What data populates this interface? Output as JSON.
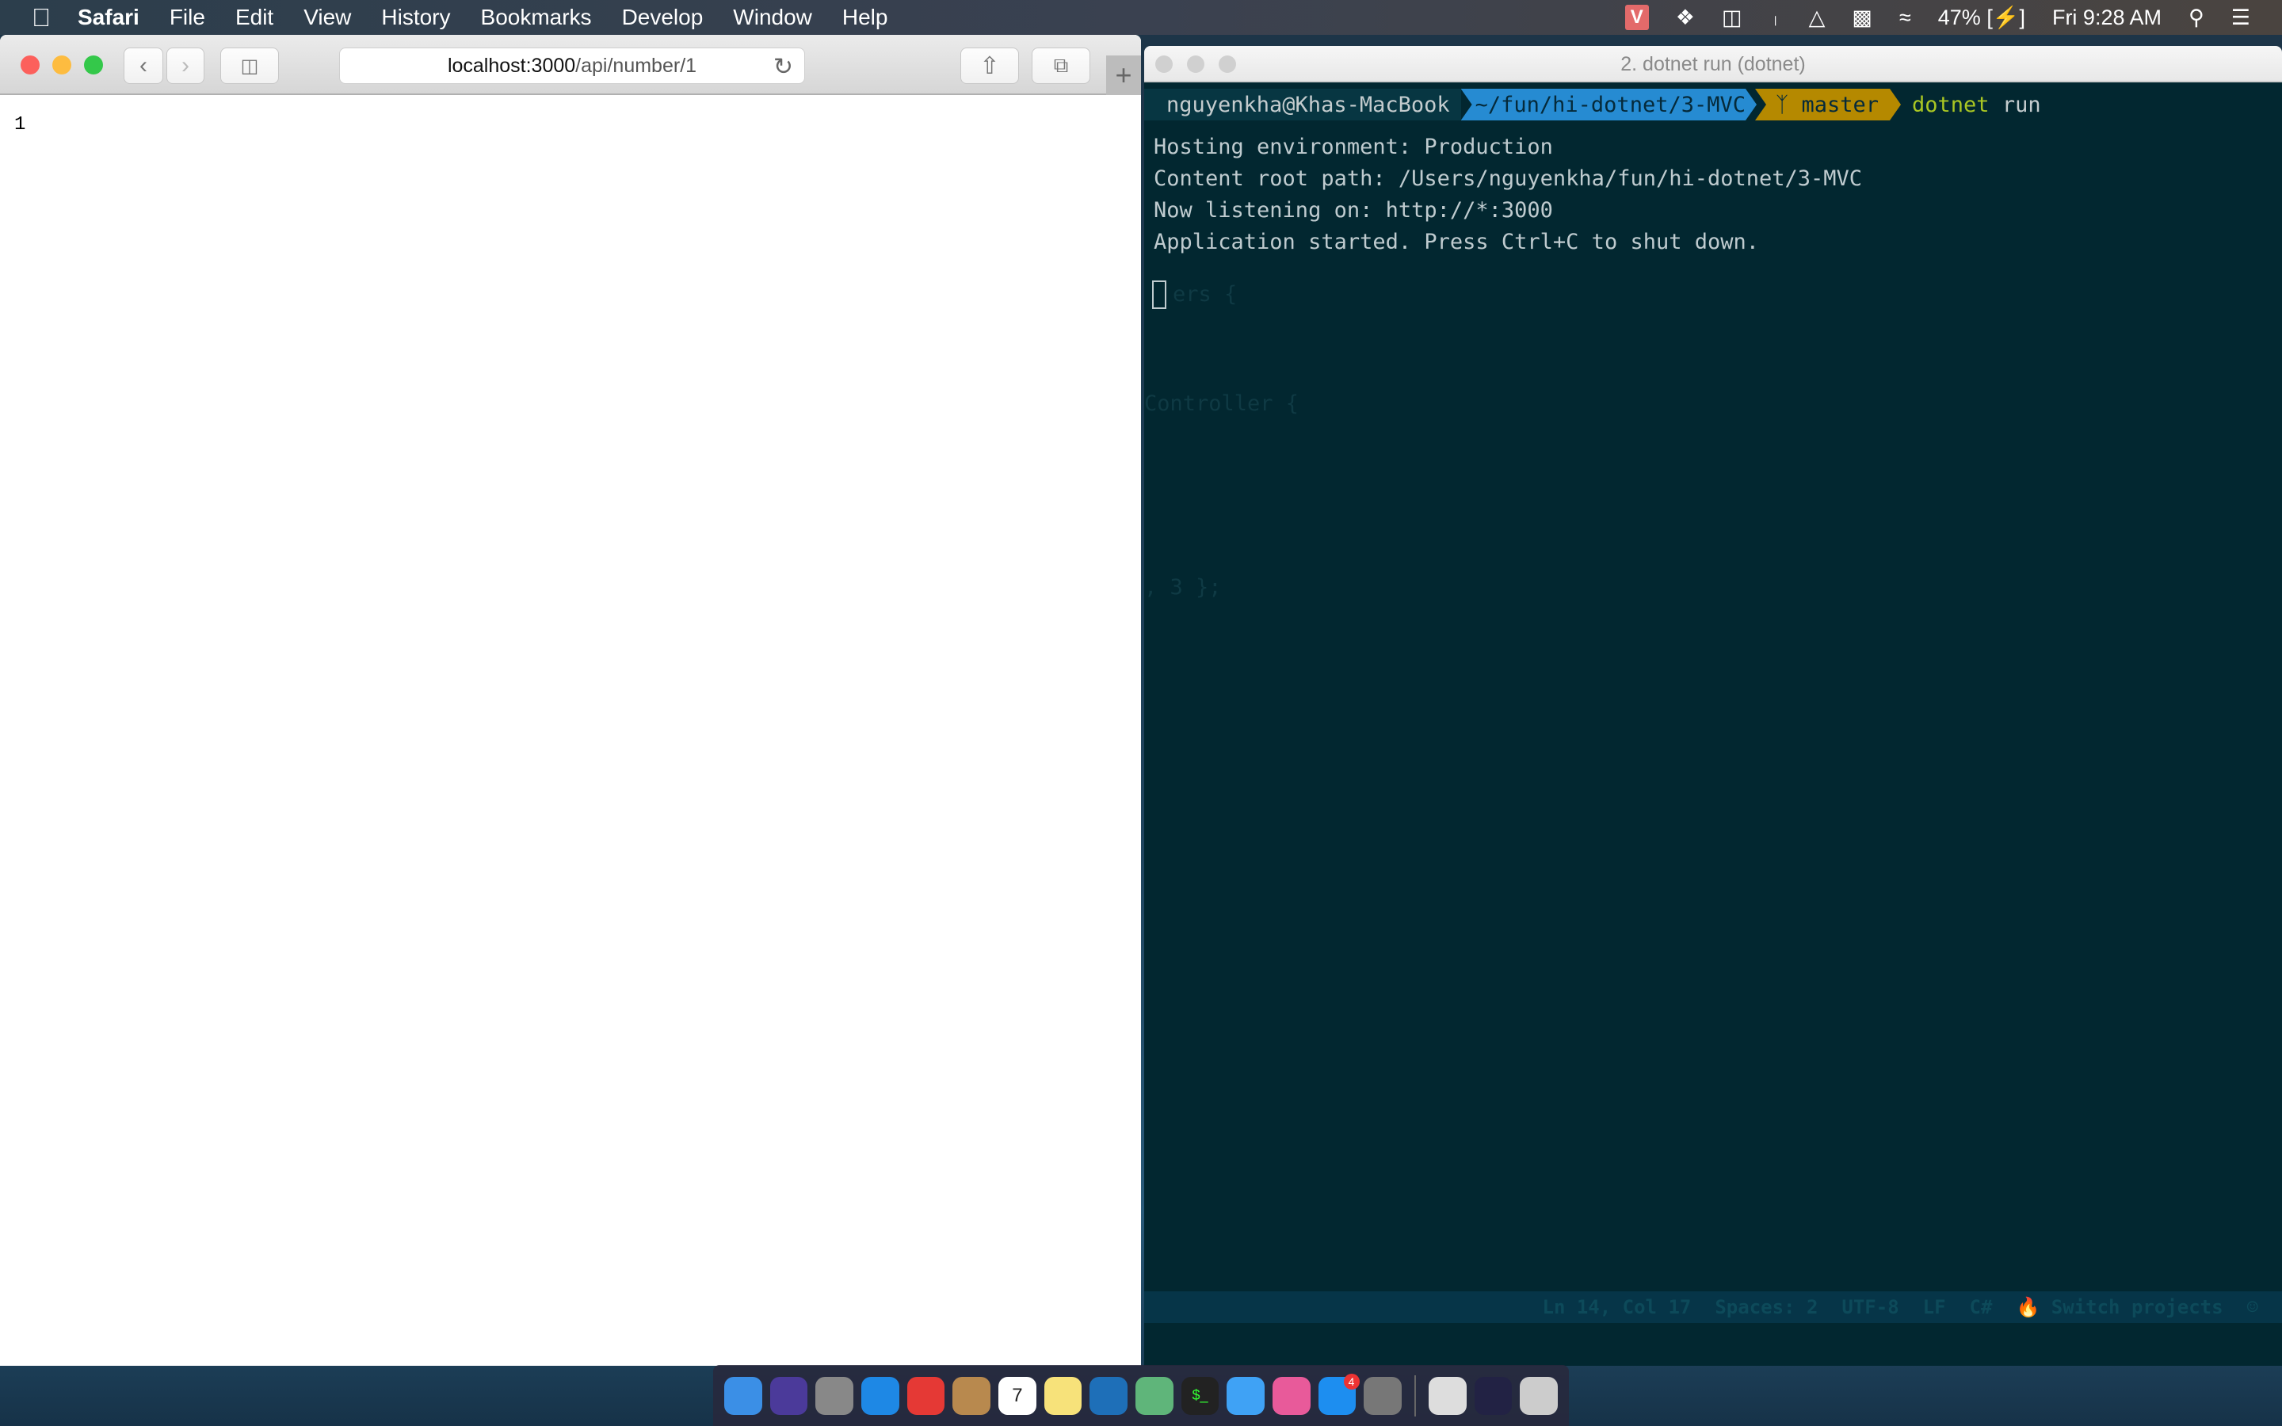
{
  "menubar": {
    "apple": "",
    "app": "Safari",
    "items": [
      "File",
      "Edit",
      "View",
      "History",
      "Bookmarks",
      "Develop",
      "Window",
      "Help"
    ],
    "status": {
      "battery": "47%",
      "clock": "Fri 9:28 AM",
      "vivaldi": "V"
    }
  },
  "safari": {
    "url_host": "localhost:3000",
    "url_path": "/api/number/1",
    "content": "1",
    "new_tab": "+"
  },
  "terminal": {
    "title": "2. dotnet run (dotnet)",
    "prompt": {
      "user": "nguyenkha@Khas-MacBook",
      "path": "~/fun/hi-dotnet/3-MVC",
      "git_branch": "master",
      "command": "dotnet",
      "args": "run"
    },
    "output": [
      "Hosting environment: Production",
      "Content root path: /Users/nguyenkha/fun/hi-dotnet/3-MVC",
      "Now listening on: http://*:3000",
      "Application started. Press Ctrl+C to shut down."
    ],
    "ghost_lines": [
      "ers {",
      "Controller {",
      ", 3 };"
    ]
  },
  "editor_status": [
    "Ln 14, Col 17",
    "Spaces: 2",
    "UTF-8",
    "LF",
    "C#",
    "Switch projects"
  ],
  "dock": {
    "apps": [
      {
        "name": "finder",
        "color": "#3b8fe6"
      },
      {
        "name": "siri",
        "color": "#4b3a9a"
      },
      {
        "name": "launchpad",
        "color": "#888"
      },
      {
        "name": "safari",
        "color": "#1e88e5"
      },
      {
        "name": "chrome",
        "color": "#e53935"
      },
      {
        "name": "contacts",
        "color": "#b8894e"
      },
      {
        "name": "calendar",
        "color": "#ffffff"
      },
      {
        "name": "notes",
        "color": "#f7e27a"
      },
      {
        "name": "vscode",
        "color": "#1e6fb8"
      },
      {
        "name": "atom",
        "color": "#5fb57a"
      },
      {
        "name": "terminal",
        "color": "#222"
      },
      {
        "name": "messages",
        "color": "#3fa2f5"
      },
      {
        "name": "itunes",
        "color": "#e85a9a"
      },
      {
        "name": "app-store",
        "color": "#1d8ef0"
      },
      {
        "name": "system-preferences",
        "color": "#777"
      }
    ],
    "calendar_day": "7",
    "app_store_badge": "4",
    "right": [
      {
        "name": "downloads",
        "color": "#ddd"
      },
      {
        "name": "screenshot-stack",
        "color": "#224"
      },
      {
        "name": "trash",
        "color": "#ccc"
      }
    ]
  }
}
